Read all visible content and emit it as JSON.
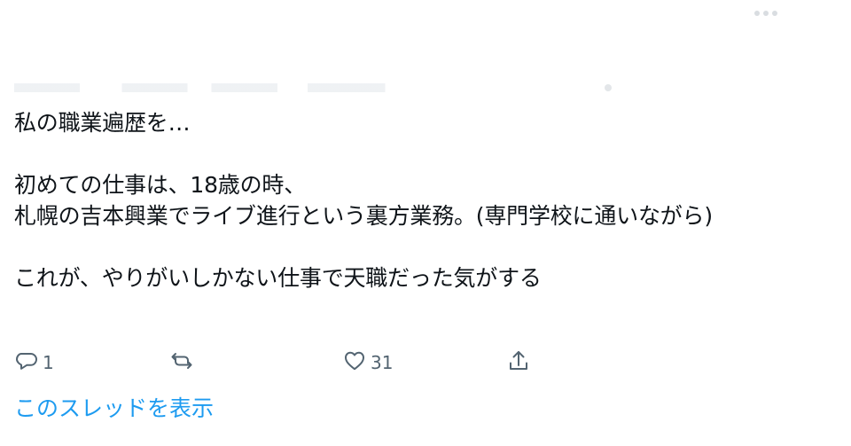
{
  "tweet": {
    "lines": [
      "私の職業遍歴を…",
      "",
      "初めての仕事は、18歳の時、",
      "札幌の吉本興業でライブ進行という裏方業務。(専門学校に通いながら)",
      "",
      "これが、やりがいしかない仕事で天職だった気がする"
    ]
  },
  "actions": {
    "reply_count": "1",
    "retweet_count": "",
    "like_count": "31",
    "icons": {
      "reply": "reply-icon",
      "retweet": "retweet-icon",
      "like": "heart-icon",
      "share": "share-icon"
    }
  },
  "thread_link": {
    "label": "このスレッドを表示"
  },
  "colors": {
    "text": "#0f1419",
    "muted": "#536471",
    "accent": "#1d9bf0"
  }
}
